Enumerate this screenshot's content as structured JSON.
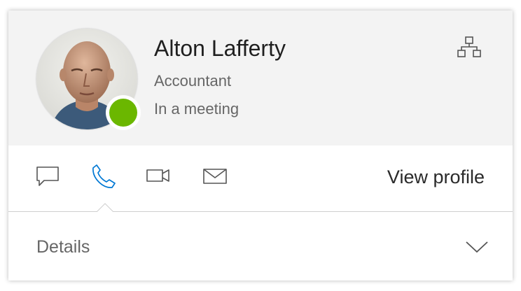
{
  "contact": {
    "name": "Alton Lafferty",
    "job_title": "Accountant",
    "status": "In a meeting",
    "presence_color": "#6bb700"
  },
  "header": {
    "org_chart_icon": "org-chart-icon"
  },
  "actions": {
    "icons": [
      "chat-icon",
      "phone-icon",
      "video-icon",
      "mail-icon"
    ],
    "selected": "phone-icon",
    "selected_color": "#0078d4",
    "view_profile_label": "View profile"
  },
  "details": {
    "label": "Details",
    "icon": "chevron-down-icon"
  }
}
